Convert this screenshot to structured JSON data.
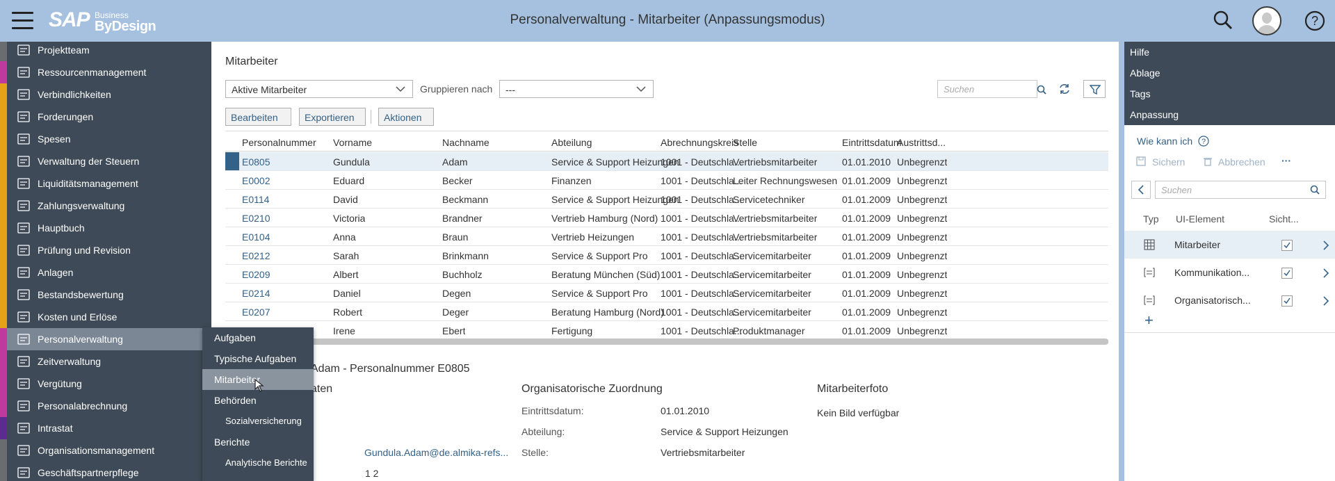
{
  "header": {
    "title": "Personalverwaltung - Mitarbeiter (Anpassungsmodus)",
    "logo_sap": "SAP",
    "logo_business": "Business",
    "logo_bydesign": "ByDesign",
    "icons": [
      "menu-icon",
      "search-icon",
      "user-icon",
      "help-icon"
    ]
  },
  "nav": {
    "items": [
      {
        "label": "Projektteam",
        "color": "#6a6d70"
      },
      {
        "label": "Ressourcenmanagement",
        "color": "#c0399f"
      },
      {
        "label": "Verbindlichkeiten",
        "color": "#e5a218"
      },
      {
        "label": "Forderungen",
        "color": "#e5a218"
      },
      {
        "label": "Spesen",
        "color": "#e5a218"
      },
      {
        "label": "Verwaltung der Steuern",
        "color": "#e5a218"
      },
      {
        "label": "Liquiditätsmanagement",
        "color": "#e5a218"
      },
      {
        "label": "Zahlungsverwaltung",
        "color": "#e5a218"
      },
      {
        "label": "Hauptbuch",
        "color": "#e5a218"
      },
      {
        "label": "Prüfung und Revision",
        "color": "#e5a218"
      },
      {
        "label": "Anlagen",
        "color": "#e5a218"
      },
      {
        "label": "Bestandsbewertung",
        "color": "#e5a218"
      },
      {
        "label": "Kosten und Erlöse",
        "color": "#e5a218"
      },
      {
        "label": "Personalverwaltung",
        "color": "#c0399f"
      },
      {
        "label": "Zeitverwaltung",
        "color": "#c0399f"
      },
      {
        "label": "Vergütung",
        "color": "#c0399f"
      },
      {
        "label": "Personalabrechnung",
        "color": "#c0399f"
      },
      {
        "label": "Intrastat",
        "color": "#5b2c8f"
      },
      {
        "label": "Organisationsmanagement",
        "color": "#6a6d70"
      },
      {
        "label": "Geschäftspartnerpflege",
        "color": "#6a6d70"
      }
    ],
    "selected_index": 13
  },
  "popup": {
    "items": [
      {
        "label": "Aufgaben",
        "sub": false
      },
      {
        "label": "Typische Aufgaben",
        "sub": false
      },
      {
        "label": "Mitarbeiter",
        "sub": false,
        "highlighted": true
      },
      {
        "label": "Behörden",
        "sub": false
      },
      {
        "label": "Sozialversicherung",
        "sub": true
      },
      {
        "label": "Berichte",
        "sub": false
      },
      {
        "label": "Analytische Berichte",
        "sub": true
      }
    ]
  },
  "main": {
    "section_title": "Mitarbeiter",
    "filter_value": "Aktive Mitarbeiter",
    "group_label": "Gruppieren nach",
    "group_value": "---",
    "search_placeholder": "Suchen",
    "buttons": {
      "edit": "Bearbeiten",
      "export": "Exportieren",
      "actions": "Aktionen"
    },
    "columns": [
      "Personalnummer",
      "Vorname",
      "Nachname",
      "Abteilung",
      "Abrechnungskreis",
      "Stelle",
      "Eintrittsdatum",
      "Austrittsd..."
    ],
    "rows": [
      [
        "E0805",
        "Gundula",
        "Adam",
        "Service & Support Heizungen",
        "1001 - Deutschla...",
        "Vertriebsmitarbeiter",
        "01.01.2010",
        "Unbegrenzt"
      ],
      [
        "E0002",
        "Eduard",
        "Becker",
        "Finanzen",
        "1001 - Deutschla...",
        "Leiter Rechnungswesen",
        "01.01.2009",
        "Unbegrenzt"
      ],
      [
        "E0114",
        "David",
        "Beckmann",
        "Service & Support Heizungen",
        "1001 - Deutschla...",
        "Servicetechniker",
        "01.01.2009",
        "Unbegrenzt"
      ],
      [
        "E0210",
        "Victoria",
        "Brandner",
        "Vertrieb Hamburg (Nord)",
        "1001 - Deutschla...",
        "Vertriebsmitarbeiter",
        "01.01.2009",
        "Unbegrenzt"
      ],
      [
        "E0104",
        "Anna",
        "Braun",
        "Vertrieb Heizungen",
        "1001 - Deutschla...",
        "Vertriebsmitarbeiter",
        "01.01.2009",
        "Unbegrenzt"
      ],
      [
        "E0212",
        "Sarah",
        "Brinkmann",
        "Service & Support Pro",
        "1001 - Deutschla...",
        "Servicemitarbeiter",
        "01.01.2009",
        "Unbegrenzt"
      ],
      [
        "E0209",
        "Albert",
        "Buchholz",
        "Beratung München (Süd)",
        "1001 - Deutschla...",
        "Servicemitarbeiter",
        "01.01.2009",
        "Unbegrenzt"
      ],
      [
        "E0214",
        "Daniel",
        "Degen",
        "Service & Support Pro",
        "1001 - Deutschla...",
        "Servicemitarbeiter",
        "01.01.2009",
        "Unbegrenzt"
      ],
      [
        "E0207",
        "Robert",
        "Deger",
        "Beratung Hamburg (Nord)",
        "1001 - Deutschla...",
        "Servicemitarbeiter",
        "01.01.2009",
        "Unbegrenzt"
      ],
      [
        "",
        "Irene",
        "Ebert",
        "Fertigung",
        "1001 - Deutschla...",
        "Produktmanager",
        "01.01.2009",
        "Unbegrenzt"
      ]
    ],
    "detail": {
      "title": "Adam - Personalnummer E0805",
      "personal_heading_fragment": "aten",
      "email": "Gundula.Adam@de.almika-refs...",
      "pages": "1 2",
      "org_heading": "Organisatorische Zuordnung",
      "entry_label": "Eintrittsdatum:",
      "entry_value": "01.01.2010",
      "dept_label": "Abteilung:",
      "dept_value": "Service & Support Heizungen",
      "job_label": "Stelle:",
      "job_value": "Vertriebsmitarbeiter",
      "photo_heading": "Mitarbeiterfoto",
      "photo_value": "Kein Bild verfügbar"
    }
  },
  "right": {
    "menu": [
      "Hilfe",
      "Ablage",
      "Tags",
      "Anpassung"
    ],
    "how_label": "Wie kann ich",
    "save_label": "Sichern",
    "cancel_label": "Abbrechen",
    "search_placeholder": "Suchen",
    "col_type": "Typ",
    "col_element": "UI-Element",
    "col_visible": "Sicht...",
    "elements": [
      {
        "label": "Mitarbeiter",
        "icon": "table-icon",
        "selected": true
      },
      {
        "label": "Kommunikation...",
        "icon": "form-icon",
        "selected": false
      },
      {
        "label": "Organisatorisch...",
        "icon": "form-icon",
        "selected": false
      }
    ]
  }
}
